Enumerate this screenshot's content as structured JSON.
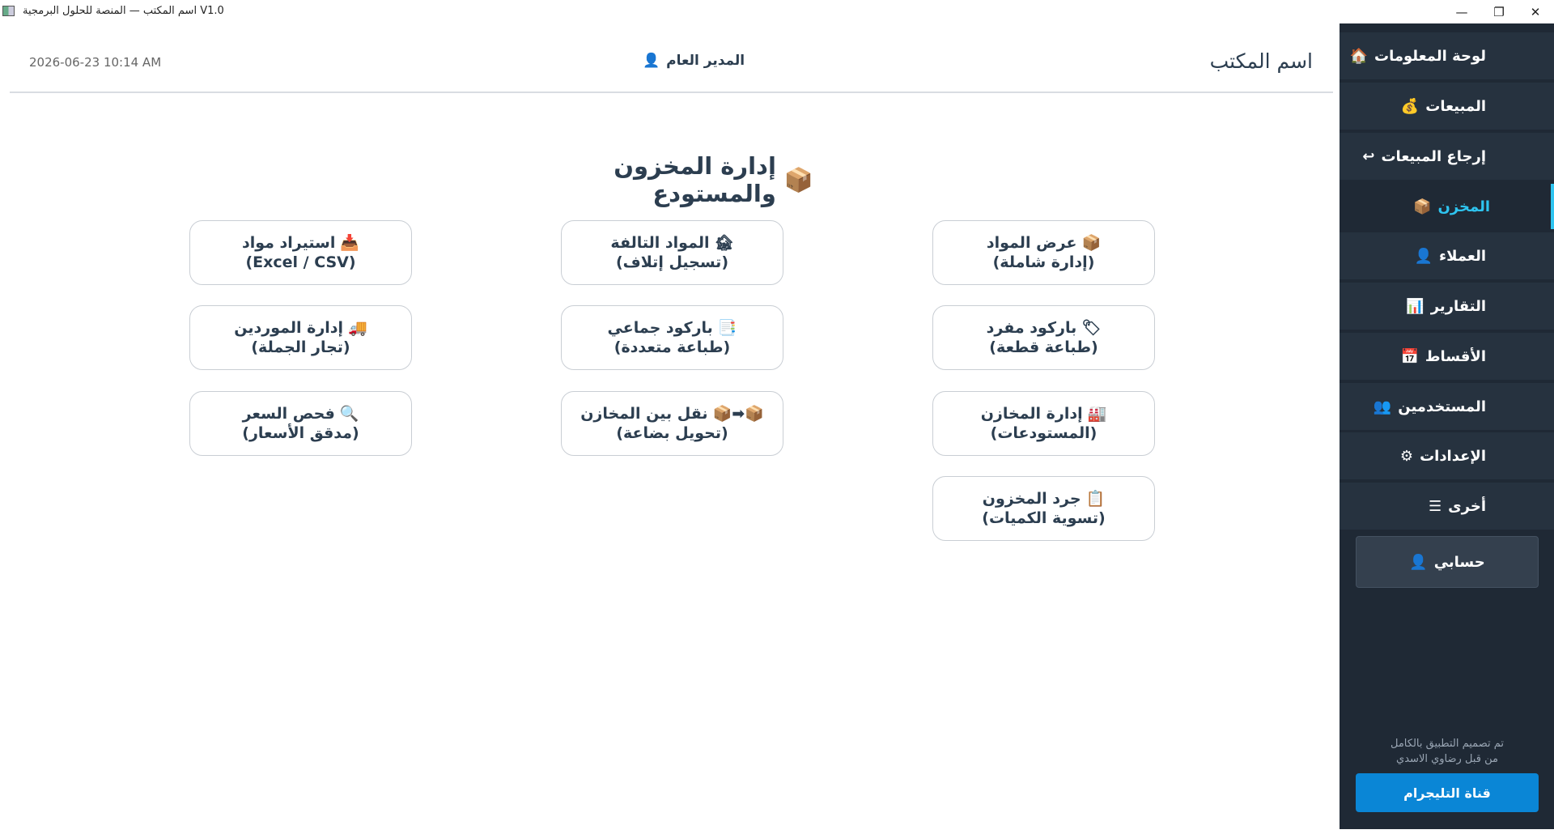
{
  "window": {
    "title": "V1.0 اسم المكتب — المنصة للحلول البرمجية",
    "minimize_icon": "minimize-icon",
    "restore_icon": "restore-icon",
    "close_icon": "close-icon"
  },
  "header": {
    "datetime": "2026-06-23  10:14 AM",
    "user_name": "المدير العام",
    "user_icon": "👤",
    "office_name": "اسم المكتب"
  },
  "page": {
    "title": "إدارة المخزون والمستودع",
    "title_icon": "📦"
  },
  "cards": [
    {
      "icon": "📦",
      "line1": "عرض المواد",
      "line2": "(إدارة شاملة)"
    },
    {
      "icon": "🏚",
      "line1": "المواد التالفة",
      "line2": "(تسجيل إتلاف)"
    },
    {
      "icon": "📥",
      "line1": "استيراد مواد",
      "line2": "(Excel / CSV)"
    },
    {
      "icon": "🏷",
      "line1": "باركود مفرد",
      "line2": "(طباعة قطعة)"
    },
    {
      "icon": "📑",
      "line1": "باركود جماعي",
      "line2": "(طباعة متعددة)"
    },
    {
      "icon": "🚚",
      "line1": "إدارة الموردين",
      "line2": "(تجار الجملة)"
    },
    {
      "icon": "🏭",
      "line1": "إدارة المخازن",
      "line2": "(المستودعات)"
    },
    {
      "icon": "📦➡📦",
      "line1": "نقل بين المخازن",
      "line2": "(تحويل بضاعة)"
    },
    {
      "icon": "🔍",
      "line1": "فحص السعر",
      "line2": "(مدقق الأسعار)"
    },
    {
      "icon": "📋",
      "line1": "جرد المخزون",
      "line2": "(تسوية الكميات)"
    }
  ],
  "sidebar": {
    "items": [
      {
        "icon": "🏠",
        "label": "لوحة المعلومات"
      },
      {
        "icon": "💰",
        "label": "المبيعات"
      },
      {
        "icon": "↩",
        "label": "إرجاع المبيعات"
      },
      {
        "icon": "📦",
        "label": "المخزن",
        "active": true
      },
      {
        "icon": "👤",
        "label": "العملاء"
      },
      {
        "icon": "📊",
        "label": "التقارير"
      },
      {
        "icon": "📅",
        "label": "الأقساط"
      },
      {
        "icon": "👥",
        "label": "المستخدمين"
      },
      {
        "icon": "⚙",
        "label": "الإعدادات"
      },
      {
        "icon": "☰",
        "label": "أخرى"
      }
    ],
    "account_label": "حسابي",
    "account_icon": "👤",
    "credit_line1": "تم تصميم التطبيق بالكامل",
    "credit_line2": "من قبل رضاوي الاسدي",
    "telegram_label": "قناة التليجرام",
    "accent_color": "#2ec4f0",
    "background_color": "#1f2935"
  }
}
